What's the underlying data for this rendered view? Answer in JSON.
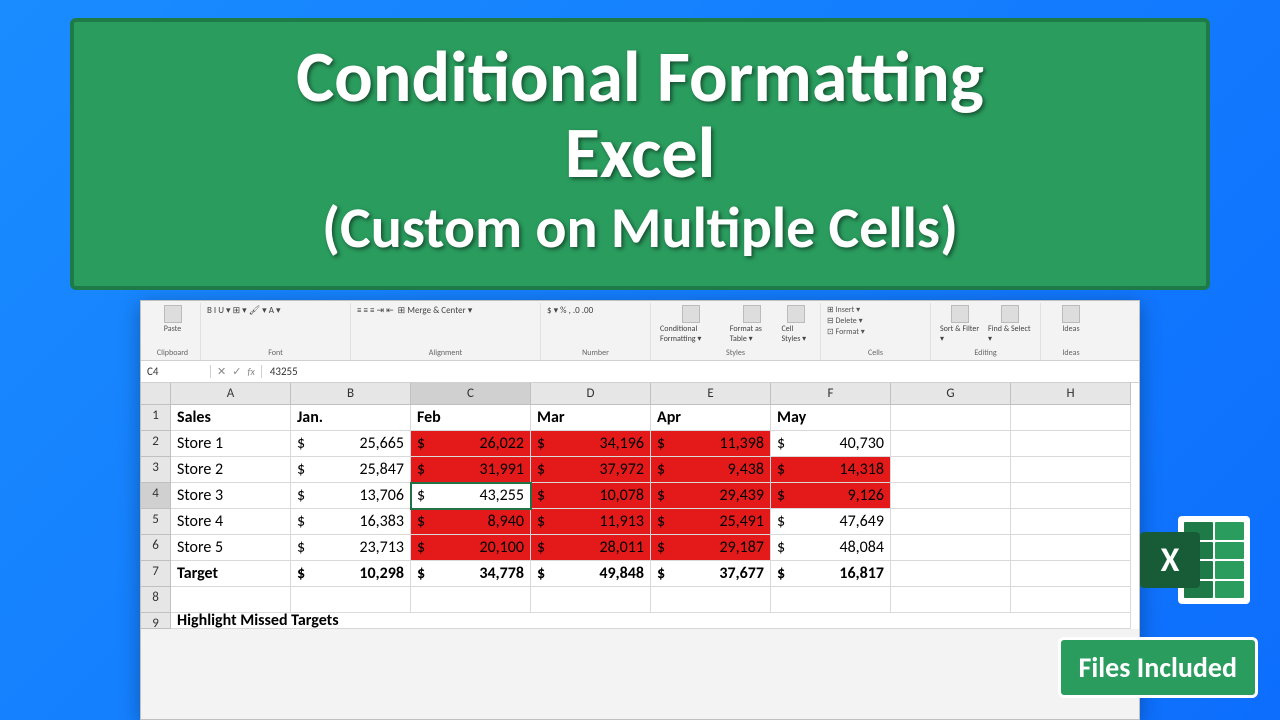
{
  "title": {
    "line1": "Conditional Formatting",
    "line2": "Excel",
    "line3": "(Custom on Multiple Cells)"
  },
  "ribbon": {
    "paste": "Paste",
    "clipboard": "Clipboard",
    "font_controls": "B  I  U ▾  ⊞ ▾  🖌 ▾  A ▾",
    "font": "Font",
    "align_controls": "≡ ≡ ≡  ⇥ ⇤",
    "merge": "⊞ Merge & Center ▾",
    "alignment": "Alignment",
    "num_controls": "$ ▾  %  ,  .0 .00",
    "number": "Number",
    "cond_fmt": "Conditional Formatting ▾",
    "fmt_table": "Format as Table ▾",
    "cell_styles": "Cell Styles ▾",
    "styles": "Styles",
    "insert": "⊞ Insert ▾",
    "delete": "⊟ Delete ▾",
    "format": "⊡ Format ▾",
    "cells": "Cells",
    "sort": "Sort & Filter ▾",
    "find": "Find & Select ▾",
    "editing": "Editing",
    "ideas": "Ideas",
    "ideas_grp": "Ideas"
  },
  "formula_bar": {
    "name_box": "C4",
    "fx": "fx",
    "value": "43255"
  },
  "columns": [
    "A",
    "B",
    "C",
    "D",
    "E",
    "F",
    "G",
    "H"
  ],
  "rows": {
    "r1": {
      "a": "Sales",
      "b": "Jan.",
      "c": "Feb",
      "d": "Mar",
      "e": "Apr",
      "f": "May"
    },
    "r2": {
      "a": "Store 1",
      "b": "25,665",
      "c": "26,022",
      "d": "34,196",
      "e": "11,398",
      "f": "40,730"
    },
    "r3": {
      "a": "Store 2",
      "b": "25,847",
      "c": "31,991",
      "d": "37,972",
      "e": "9,438",
      "f": "14,318"
    },
    "r4": {
      "a": "Store 3",
      "b": "13,706",
      "c": "43,255",
      "d": "10,078",
      "e": "29,439",
      "f": "9,126"
    },
    "r5": {
      "a": "Store 4",
      "b": "16,383",
      "c": "8,940",
      "d": "11,913",
      "e": "25,491",
      "f": "47,649"
    },
    "r6": {
      "a": "Store 5",
      "b": "23,713",
      "c": "20,100",
      "d": "28,011",
      "e": "29,187",
      "f": "48,084"
    },
    "r7": {
      "a": "Target",
      "b": "10,298",
      "c": "34,778",
      "d": "49,848",
      "e": "37,677",
      "f": "16,817"
    }
  },
  "dollar": "$",
  "note": "Highlight Missed Targets",
  "badge": "Files Included",
  "excel_letter": "X"
}
